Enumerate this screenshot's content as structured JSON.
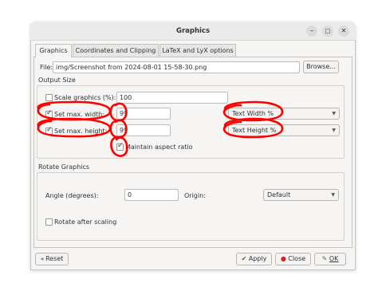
{
  "window": {
    "title": "Graphics",
    "minimize_glyph": "‒",
    "maximize_glyph": "□",
    "close_glyph": "✕"
  },
  "tabs": [
    {
      "label": "Graphics",
      "active": true
    },
    {
      "label": "Coordinates and Clipping",
      "active": false
    },
    {
      "label": "LaTeX and LyX options",
      "active": false
    }
  ],
  "file": {
    "label": "File:",
    "value": "img/Screenshot from 2024-08-01 15-58-30.png",
    "browse_label": "Browse..."
  },
  "output_size": {
    "heading": "Output Size",
    "scale_label": "Scale graphics (%):",
    "scale_checked": false,
    "scale_value": "100",
    "width_label": "Set max. width:",
    "width_checked": true,
    "width_value": "99",
    "width_unit": "Text Width %",
    "height_label": "Set max. height:",
    "height_checked": true,
    "height_value": "99",
    "height_unit": "Text Height %",
    "aspect_label": "Maintain aspect ratio",
    "aspect_checked": true
  },
  "rotate": {
    "heading": "Rotate Graphics",
    "angle_label": "Angle (degrees):",
    "angle_value": "0",
    "origin_label": "Origin:",
    "origin_value": "Default",
    "after_scaling_label": "Rotate after scaling",
    "after_scaling_checked": false
  },
  "buttons": {
    "reset": "Reset",
    "apply": "Apply",
    "close": "Close",
    "ok": "OK"
  },
  "colors": {
    "annotation": "#ff0000",
    "close_icon": "#e01b24",
    "apply_icon": "#3a7a2a"
  }
}
